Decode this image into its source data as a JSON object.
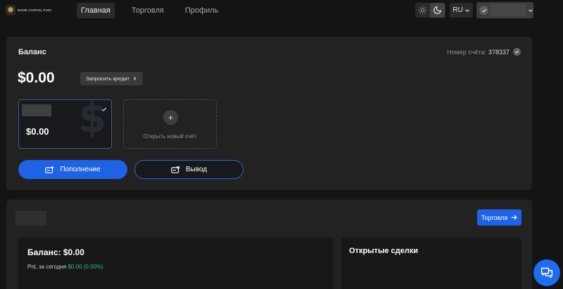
{
  "logo": {
    "text": "NOOR CAPITAL PJSC"
  },
  "nav": {
    "tabs": [
      {
        "label": "Главная"
      },
      {
        "label": "Торговля"
      },
      {
        "label": "Профиль"
      }
    ]
  },
  "header": {
    "language": "RU",
    "theme": "dark"
  },
  "balance_card": {
    "title": "Баланс",
    "account_number_label": "Номер счёта:",
    "account_number": "378337",
    "amount": "$0.00",
    "credit_button": "Запросить кредит",
    "account_tile": {
      "amount": "$0.00"
    },
    "new_account_label": "Открыть новый счёт",
    "deposit_button": "Пополнение",
    "withdraw_button": "Вывод"
  },
  "lower_card": {
    "trade_button": "Торговля",
    "summary": {
      "title": "Баланс: $0.00",
      "pnl_label": "Pnl, за сегодня",
      "pnl_value": "$0.00 (0.00%)"
    },
    "open_trades_title": "Открытые сделки"
  },
  "colors": {
    "accent": "#1e63e6",
    "profit": "#2ebd85",
    "card": "#222222",
    "background": "#141414"
  }
}
